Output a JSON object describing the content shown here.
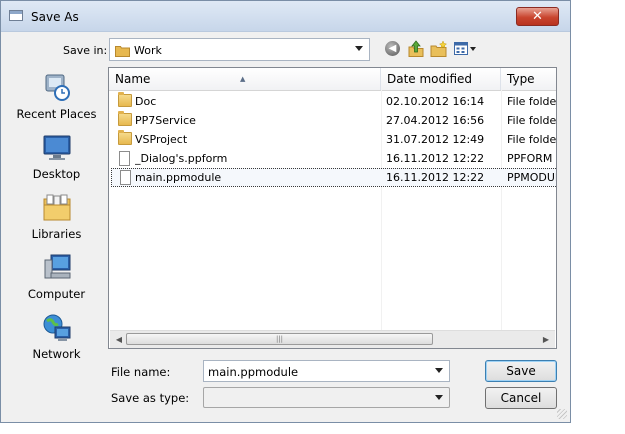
{
  "window": {
    "title": "Save As",
    "close_glyph": "✕"
  },
  "save_in": {
    "label": "Save in:",
    "value": "Work"
  },
  "toolbar": {
    "back_glyph": "◀"
  },
  "places": [
    {
      "label": "Recent Places",
      "icon": "recent-places-icon"
    },
    {
      "label": "Desktop",
      "icon": "desktop-icon"
    },
    {
      "label": "Libraries",
      "icon": "libraries-icon"
    },
    {
      "label": "Computer",
      "icon": "computer-icon"
    },
    {
      "label": "Network",
      "icon": "network-icon"
    }
  ],
  "columns": {
    "name": "Name",
    "date": "Date modified",
    "type": "Type"
  },
  "files": [
    {
      "name": "Doc",
      "date": "02.10.2012 16:14",
      "type": "File folder",
      "kind": "folder"
    },
    {
      "name": "PP7Service",
      "date": "27.04.2012 16:56",
      "type": "File folder",
      "kind": "folder"
    },
    {
      "name": "VSProject",
      "date": "31.07.2012 12:49",
      "type": "File folder",
      "kind": "folder"
    },
    {
      "name": "_Dialog's.ppform",
      "date": "16.11.2012 12:22",
      "type": "PPFORM File",
      "kind": "file"
    },
    {
      "name": "main.ppmodule",
      "date": "16.11.2012 12:22",
      "type": "PPMODULE File",
      "kind": "file",
      "selected": true
    }
  ],
  "file_name": {
    "label": "File name:",
    "value": "main.ppmodule"
  },
  "save_as_type": {
    "label": "Save as type:",
    "value": ""
  },
  "buttons": {
    "save": "Save",
    "cancel": "Cancel"
  },
  "colors": {
    "title_bar": "#c7d6ea",
    "close_button": "#c9452f",
    "dialog_bg": "#f0f0f0",
    "folder": "#e7b84f"
  }
}
